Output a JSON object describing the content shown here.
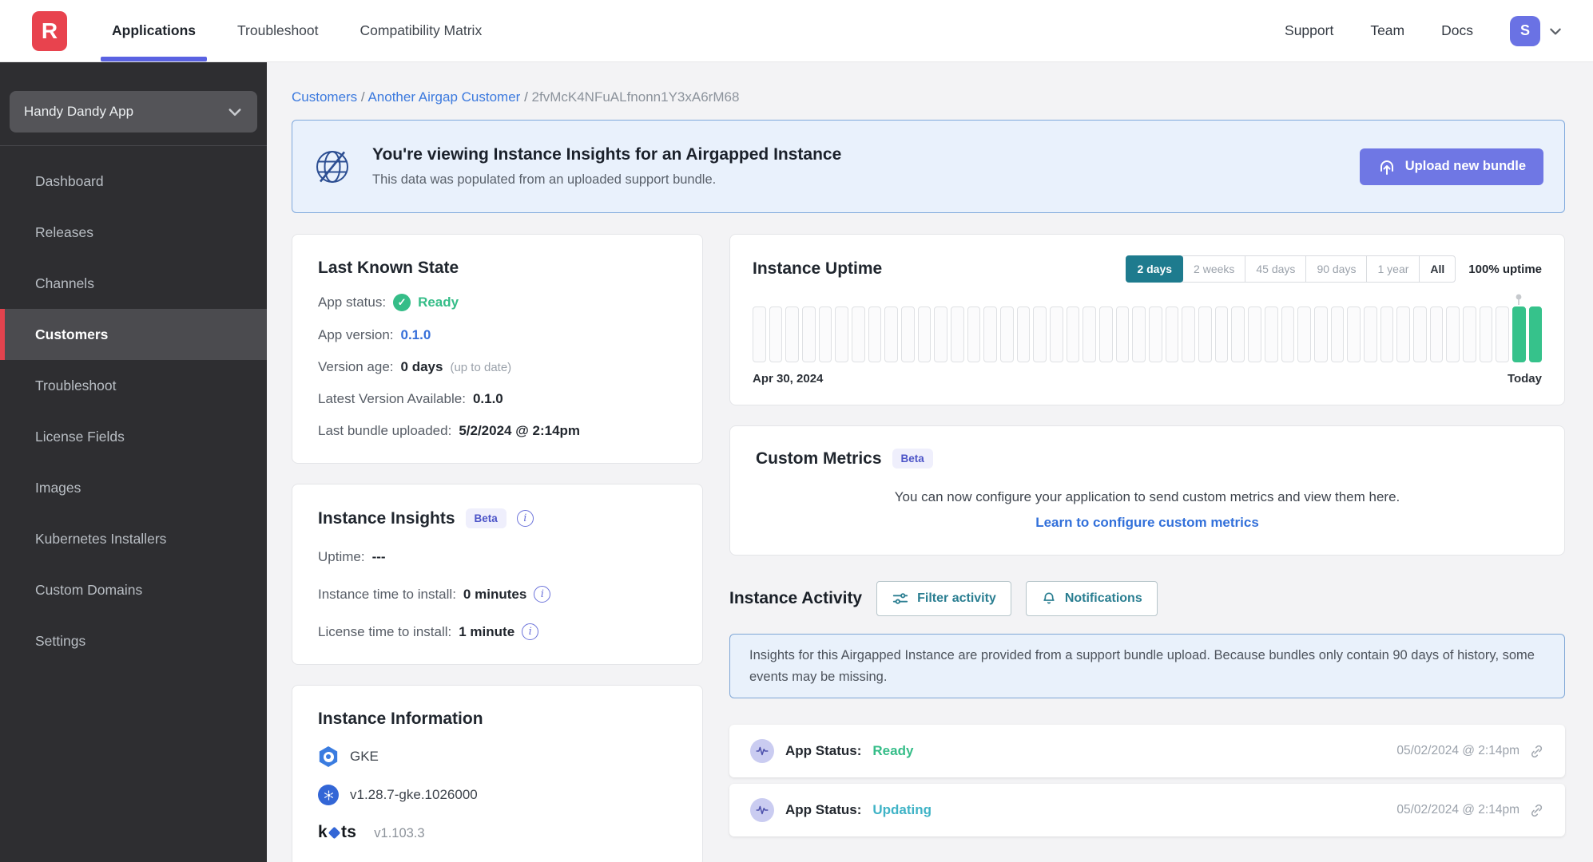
{
  "colors": {
    "logo_red": "#e8434e",
    "accent_indigo": "#6f77e4",
    "accent_teal": "#1e7b8e",
    "status_ready_green": "#35bd88",
    "status_updating_teal": "#3fb3c6",
    "link_blue": "#366fd9",
    "uptime_bar_green": "#36c28b"
  },
  "nav": {
    "logo_letter": "R",
    "tabs": [
      {
        "label": "Applications",
        "active": true
      },
      {
        "label": "Troubleshoot",
        "active": false
      },
      {
        "label": "Compatibility Matrix",
        "active": false
      }
    ],
    "links": [
      "Support",
      "Team",
      "Docs"
    ],
    "avatar_initial": "S"
  },
  "sidebar": {
    "app_selector": {
      "label": "Handy Dandy App"
    },
    "items": [
      {
        "label": "Dashboard",
        "active": false
      },
      {
        "label": "Releases",
        "active": false
      },
      {
        "label": "Channels",
        "active": false
      },
      {
        "label": "Customers",
        "active": true
      },
      {
        "label": "Troubleshoot",
        "active": false
      },
      {
        "label": "License Fields",
        "active": false
      },
      {
        "label": "Images",
        "active": false
      },
      {
        "label": "Kubernetes Installers",
        "active": false
      },
      {
        "label": "Custom Domains",
        "active": false
      },
      {
        "label": "Settings",
        "active": false
      }
    ]
  },
  "breadcrumb": {
    "links": [
      "Customers",
      "Another Airgap Customer"
    ],
    "current": "2fvMcK4NFuALfnonn1Y3xA6rM68",
    "separator": "/"
  },
  "banner": {
    "title": "You're viewing Instance Insights for an Airgapped Instance",
    "subtitle": "This data was populated from an uploaded support bundle.",
    "upload_button": "Upload new bundle"
  },
  "last_known_state": {
    "title": "Last Known State",
    "app_status_label": "App status:",
    "app_status_value": "Ready",
    "app_version_label": "App version:",
    "app_version_value": "0.1.0",
    "version_age_label": "Version age:",
    "version_age_value": "0 days",
    "version_age_note": "(up to date)",
    "latest_version_label": "Latest Version Available:",
    "latest_version_value": "0.1.0",
    "last_bundle_label": "Last bundle uploaded:",
    "last_bundle_value": "5/2/2024 @ 2:14pm"
  },
  "instance_insights": {
    "title": "Instance Insights",
    "beta_badge": "Beta",
    "uptime_label": "Uptime:",
    "uptime_value": "---",
    "instance_install_label": "Instance time to install:",
    "instance_install_value": "0 minutes",
    "license_install_label": "License time to install:",
    "license_install_value": "1 minute"
  },
  "instance_information": {
    "title": "Instance Information",
    "distribution": "GKE",
    "k8s_version": "v1.28.7-gke.1026000",
    "kots_prefix": "k",
    "kots_suffix": "ts",
    "kots_version": "v1.103.3"
  },
  "instance_uptime": {
    "title": "Instance Uptime",
    "ranges": [
      {
        "label": "2 days",
        "active": true,
        "emphasis": false
      },
      {
        "label": "2 weeks",
        "active": false,
        "emphasis": false
      },
      {
        "label": "45 days",
        "active": false,
        "emphasis": false
      },
      {
        "label": "90 days",
        "active": false,
        "emphasis": false
      },
      {
        "label": "1 year",
        "active": false,
        "emphasis": false
      },
      {
        "label": "All",
        "active": false,
        "emphasis": true
      }
    ],
    "uptime_summary": "100% uptime",
    "start_label": "Apr 30, 2024",
    "end_label": "Today",
    "chart": {
      "type": "uptime-bars",
      "total_bars": 48,
      "up_bars_at_end": 2,
      "up_color": "#36c28b",
      "empty_color": "#fbfbfc"
    }
  },
  "custom_metrics": {
    "title": "Custom Metrics",
    "beta_badge": "Beta",
    "body": "You can now configure your application to send custom metrics and view them here.",
    "link": "Learn to configure custom metrics"
  },
  "instance_activity": {
    "title": "Instance Activity",
    "filter_button": "Filter activity",
    "notifications_button": "Notifications",
    "info": "Insights for this Airgapped Instance are provided from a support bundle upload. Because bundles only contain 90 days of history, some events may be missing.",
    "events": [
      {
        "label": "App Status:",
        "status": "Ready",
        "status_color": "#35bd88",
        "timestamp": "05/02/2024 @ 2:14pm"
      },
      {
        "label": "App Status:",
        "status": "Updating",
        "status_color": "#3fb3c6",
        "timestamp": "05/02/2024 @ 2:14pm"
      }
    ]
  }
}
